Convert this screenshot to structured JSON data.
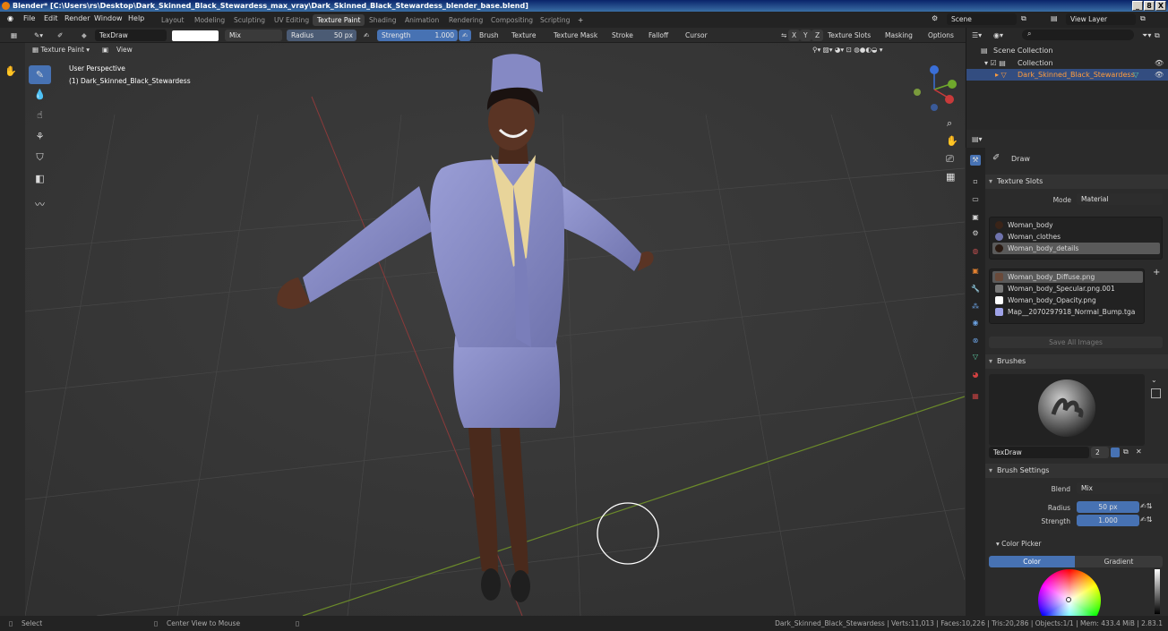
{
  "window": {
    "title": "Blender* [C:\\Users\\rs\\Desktop\\Dark_Skinned_Black_Stewardess_max_vray\\Dark_Skinned_Black_Stewardess_blender_base.blend]",
    "min": "_",
    "max": "8",
    "close": "X"
  },
  "menu": [
    "File",
    "Edit",
    "Render",
    "Window",
    "Help"
  ],
  "workspaces": [
    "Layout",
    "Modeling",
    "Sculpting",
    "UV Editing",
    "Texture Paint",
    "Shading",
    "Animation",
    "Rendering",
    "Compositing",
    "Scripting",
    "+"
  ],
  "scene": "Scene",
  "view_layer": "View Layer",
  "tool_header": {
    "brush_name": "TexDraw",
    "blend": "Mix",
    "radius_label": "Radius",
    "radius": "50 px",
    "strength_label": "Strength",
    "strength": "1.000",
    "menus": [
      "Brush",
      "Texture",
      "Texture Mask",
      "Stroke",
      "Falloff",
      "Cursor"
    ],
    "axes": [
      "X",
      "Y",
      "Z"
    ],
    "texture_slots": "Texture Slots",
    "masking": "Masking",
    "options": "Options"
  },
  "viewport": {
    "mode": "Texture Paint",
    "view": "View",
    "perspective": "User Perspective",
    "object": "(1) Dark_Skinned_Black_Stewardess"
  },
  "outliner": {
    "scene_collection": "Scene Collection",
    "collection": "Collection",
    "object": "Dark_Skinned_Black_Stewardess"
  },
  "props": {
    "tool": "Draw",
    "texture_slots": "Texture Slots",
    "mode_label": "Mode",
    "mode": "Material",
    "materials": [
      "Woman_body",
      "Woman_clothes",
      "Woman_body_details"
    ],
    "images": [
      "Woman_body_Diffuse.png",
      "Woman_body_Specular.png.001",
      "Woman_body_Opacity.png",
      "Map__2070297918_Normal_Bump.tga"
    ],
    "save_all": "Save All Images",
    "brushes": "Brushes",
    "brush_name": "TexDraw",
    "brush_users": "2",
    "brush_settings": "Brush Settings",
    "blend_label": "Blend",
    "blend": "Mix",
    "radius_label": "Radius",
    "radius": "50 px",
    "strength_label": "Strength",
    "strength": "1.000",
    "color_picker": "Color Picker",
    "color_tab": "Color",
    "gradient_tab": "Gradient"
  },
  "status": {
    "select": "Select",
    "center": "Center View to Mouse",
    "info": "Dark_Skinned_Black_Stewardess | Verts:11,013 | Faces:10,226 | Tris:20,286 | Objects:1/1 | Mem: 433.4 MiB | 2.83.1"
  },
  "colors": {
    "accent": "#4772b3",
    "uniform": "#8589c4",
    "skin": "#5a3424",
    "scarf": "#e8d49a"
  }
}
